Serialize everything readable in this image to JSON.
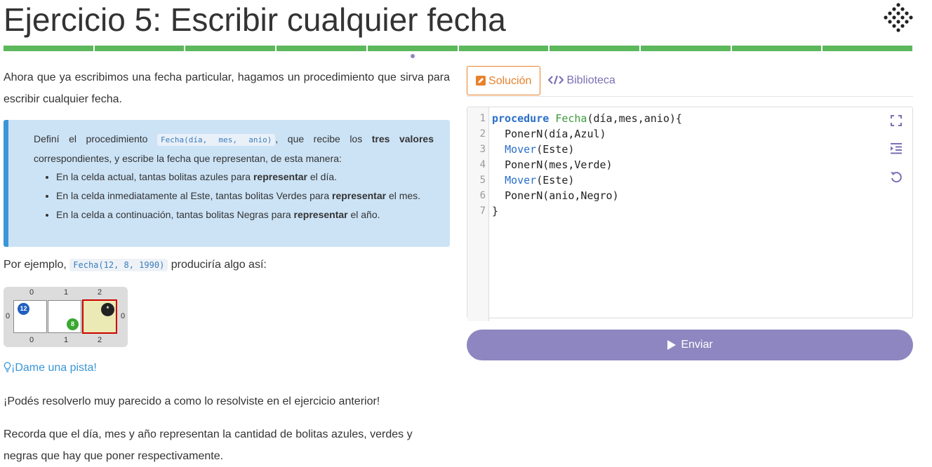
{
  "header": {
    "title": "Ejercicio 5: Escribir cualquier fecha",
    "logo_icon": "mumuki-logo-icon"
  },
  "progress": {
    "segments": 10,
    "completed": 10,
    "color": "#5cb85c"
  },
  "instructions": {
    "intro": "Ahora que ya escribimos una fecha particular, hagamos un procedimiento que sirva para escribir cualquier fecha.",
    "callout_pre": "Definí el procedimiento ",
    "callout_code": "Fecha(día, mes, anio)",
    "callout_mid": ", que recibe los ",
    "callout_bold": "tres valores",
    "callout_post": " correspondientes, y escribe la fecha que representan, de esta manera:",
    "bullets": [
      {
        "pre": "En la celda actual, tantas bolitas azules para ",
        "bold": "representar",
        "post": " el día."
      },
      {
        "pre": "En la celda inmediatamente al Este, tantas bolitas Verdes para ",
        "bold": "representar",
        "post": " el mes."
      },
      {
        "pre": "En la celda a continuación, tantas bolitas Negras para ",
        "bold": "representar",
        "post": " el año."
      }
    ],
    "example_pre": "Por ejemplo, ",
    "example_code": "Fecha(12, 8, 1990)",
    "example_post": " produciría algo así:",
    "board": {
      "col_labels": [
        "0",
        "1",
        "2"
      ],
      "row_labels": [
        "0"
      ],
      "balls": [
        {
          "color": "blue",
          "hex": "#1f5fbf",
          "count": "12"
        },
        {
          "color": "green",
          "hex": "#3aa832",
          "count": "8"
        },
        {
          "color": "black",
          "hex": "#222222",
          "count": "*"
        }
      ]
    },
    "hint": "¡Dame una pista!",
    "hint_icon": "lightbulb-icon",
    "hint_p1": "¡Podés resolverlo muy parecido a como lo resolviste en el ejercicio anterior!",
    "hint_p2": "Recorda que el día, mes y año representan la cantidad de bolitas azules, verdes y negras que hay que poner respectivamente."
  },
  "editor": {
    "tabs": {
      "solution": "Solución",
      "library": "Biblioteca"
    },
    "line_numbers": [
      "1",
      "2",
      "3",
      "4",
      "5",
      "6",
      "7"
    ],
    "code": [
      {
        "kw": "procedure",
        "fn": "Fecha",
        "rest": "(día,mes,anio){"
      },
      {
        "indent": "  ",
        "text": "PonerN(día,Azul)"
      },
      {
        "indent": "  ",
        "mv": "Mover",
        "rest": "(Este)"
      },
      {
        "indent": "  ",
        "text": "PonerN(mes,Verde)"
      },
      {
        "indent": "  ",
        "mv": "Mover",
        "rest": "(Este)"
      },
      {
        "indent": "  ",
        "text": "PonerN(anio,Negro)"
      },
      {
        "text": "}"
      }
    ],
    "icons": [
      "fullscreen-icon",
      "indent-icon",
      "reset-icon"
    ],
    "submit": "Enviar"
  },
  "colors": {
    "accent": "#8e86c0",
    "solution_tab": "#e8822b",
    "callout_bg": "#cce3f6",
    "callout_border": "#3a96d6"
  }
}
